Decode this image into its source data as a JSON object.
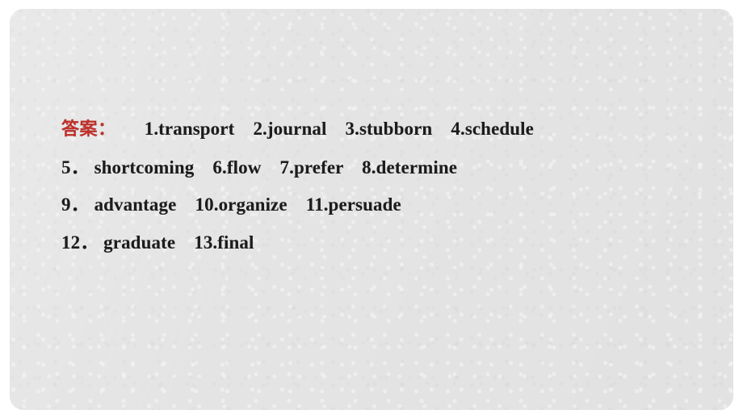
{
  "slide": {
    "panel_bg_color": "#e4e4e4",
    "canvas_bg_color": "#ffffff",
    "answer_label_color": "#c0302b",
    "answer_text_color": "#1c1c1c"
  },
  "answers": {
    "label": "答案：",
    "lines": [
      {
        "id": "line-1",
        "lead": "",
        "text": "1.transport　2.journal　3.stubborn　4.schedule",
        "items": [
          {
            "number": "1.",
            "word": "transport"
          },
          {
            "number": "2.",
            "word": "journal"
          },
          {
            "number": "3.",
            "word": "stubborn"
          },
          {
            "number": "4.",
            "word": "schedule"
          }
        ]
      },
      {
        "id": "line-2",
        "lead": "5．",
        "text": "shortcoming　6.flow　7.prefer　8.determine",
        "items": [
          {
            "number": "5.",
            "word": "shortcoming"
          },
          {
            "number": "6.",
            "word": "flow"
          },
          {
            "number": "7.",
            "word": "prefer"
          },
          {
            "number": "8.",
            "word": "determine"
          }
        ]
      },
      {
        "id": "line-3",
        "lead": "9．",
        "text": "advantage　10.organize　11.persuade",
        "items": [
          {
            "number": "9.",
            "word": "advantage"
          },
          {
            "number": "10.",
            "word": "organize"
          },
          {
            "number": "11.",
            "word": "persuade"
          }
        ]
      },
      {
        "id": "line-4",
        "lead": "12．",
        "text": "graduate　13.final",
        "items": [
          {
            "number": "12.",
            "word": "graduate"
          },
          {
            "number": "13.",
            "word": "final"
          }
        ]
      }
    ]
  }
}
